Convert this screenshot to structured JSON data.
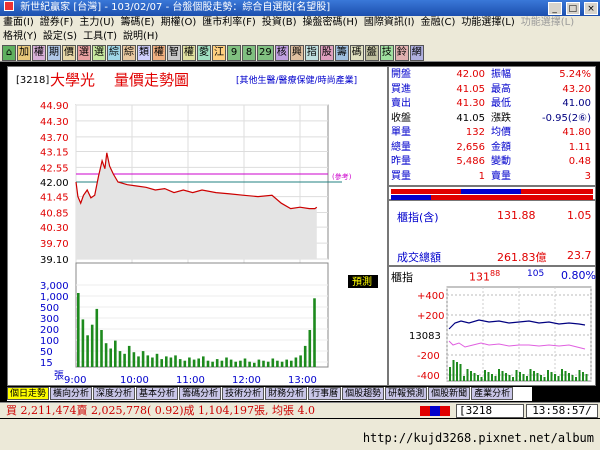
{
  "window": {
    "title": "新世紀贏家 [台灣] - 103/02/07 - 台盤個股走勢：綜合自選股[名望股]",
    "controls": [
      "_",
      "□",
      "×"
    ]
  },
  "menu1": [
    "畫面(I)",
    "證券(F)",
    "主力(U)",
    "籌碼(E)",
    "期權(O)",
    "匯市利率(F)",
    "投資(B)",
    "操盤密碼(H)",
    "國際資訊(I)",
    "金融(C)",
    "功能選擇(L)",
    "功能選擇(L)"
  ],
  "menu2": [
    "格視(Y)",
    "設定(S)",
    "工具(T)",
    "說明(H)"
  ],
  "toolbar": [
    "⌂",
    "加",
    "權",
    "期",
    "價",
    "選",
    "選",
    "綜",
    "綜",
    "類",
    "權",
    "智",
    "權",
    "愛",
    "江",
    "9",
    "8",
    "29",
    "核",
    "興",
    "指",
    "股",
    "籌",
    "碼",
    "盤",
    "技",
    "鈴",
    "網"
  ],
  "stock": {
    "code": "[3218]",
    "name": "大學光",
    "chart_title": "量價走勢圖",
    "sector": "[其他生醫/醫療保健/時尚產業]",
    "ref_label": "(參考)",
    "predict_label": "預測",
    "vol_axis_label": "張"
  },
  "quote": {
    "rows": [
      {
        "l1": "開盤",
        "v1": "42.00",
        "l2": "振幅",
        "v2": "5.24%"
      },
      {
        "l1": "買進",
        "v1": "41.05",
        "l2": "最高",
        "v2": "43.20"
      },
      {
        "l1": "賣出",
        "v1": "41.30",
        "l2": "最低",
        "v2": "41.00"
      },
      {
        "l1": "收盤",
        "v1": "41.05",
        "l2": "漲跌",
        "v2": "-0.95(2⑥)"
      },
      {
        "l1": "單量",
        "v1": "132",
        "l2": "均價",
        "v2": "41.80"
      },
      {
        "l1": "總量",
        "v1": "2,656",
        "l2": "金額",
        "v2": "1.11"
      },
      {
        "l1": "昨量",
        "v1": "5,486",
        "l2": "變動",
        "v2": "0.48"
      },
      {
        "l1": "買量",
        "v1": "1",
        "l2": "賣量",
        "v2": "3"
      }
    ]
  },
  "index_box": {
    "label1": "櫃指(含)",
    "value1": "131.88",
    "change1": "1.05",
    "label2": "成交總額",
    "value2": "261.83億",
    "change2": "23.7"
  },
  "mini": {
    "label": "櫃指",
    "value": "131",
    "value_sup": "88",
    "change": "105",
    "pct": "0.80%",
    "y_labels": [
      "+400",
      "+200",
      "13083",
      "-200",
      "-400"
    ]
  },
  "tabs": [
    "個日走勢",
    "橫向分析",
    "深度分析",
    "基本分析",
    "籌碼分析",
    "技術分析",
    "財務分析",
    "行事曆",
    "個股趨勢",
    "研報預測",
    "個股新聞",
    "產業分析"
  ],
  "status": {
    "summary": "買 2,211,474賣 2,025,778( 0.92)成 1,104,197張, 均張 4.0",
    "code": "[3218",
    "clock": "13:58:57/"
  },
  "url": "http://kujd3268.pixnet.net/album",
  "colors": {
    "up": "#e00000",
    "down": "#0000cc",
    "price_line": "#cc0000",
    "avg_line": "#cc00cc",
    "volume": "#1d8a1d",
    "chart_bg": "#ffffff"
  },
  "chart_data": {
    "type": "line",
    "x_ticks": [
      "9:00",
      "10:00",
      "11:00",
      "12:00",
      "13:00"
    ],
    "price_ticks": [
      "44.90",
      "44.30",
      "43.70",
      "43.15",
      "42.55",
      "42.00",
      "41.45",
      "40.85",
      "40.30",
      "39.70",
      "39.10"
    ],
    "volume_ticks": [
      "3,000",
      "1,000",
      "500",
      "300",
      "200",
      "100",
      "50",
      "15"
    ],
    "price_range": [
      39.1,
      44.9
    ],
    "ref_price": 42.0,
    "avg_price": 42.3,
    "price_series": [
      [
        0,
        42.0
      ],
      [
        2,
        41.45
      ],
      [
        5,
        41.2
      ],
      [
        8,
        41.5
      ],
      [
        12,
        41.7
      ],
      [
        16,
        41.4
      ],
      [
        20,
        41.5
      ],
      [
        24,
        42.2
      ],
      [
        28,
        42.8
      ],
      [
        31,
        42.5
      ],
      [
        33,
        43.1
      ],
      [
        36,
        42.6
      ],
      [
        40,
        42.3
      ],
      [
        45,
        42.0
      ],
      [
        55,
        41.9
      ],
      [
        65,
        41.85
      ],
      [
        75,
        41.8
      ],
      [
        85,
        41.7
      ],
      [
        95,
        41.75
      ],
      [
        105,
        41.6
      ],
      [
        115,
        41.7
      ],
      [
        125,
        41.6
      ],
      [
        135,
        41.7
      ],
      [
        150,
        41.6
      ],
      [
        165,
        41.55
      ],
      [
        180,
        41.5
      ],
      [
        195,
        41.45
      ],
      [
        210,
        41.5
      ],
      [
        220,
        41.2
      ],
      [
        230,
        41.0
      ],
      [
        240,
        41.05
      ],
      [
        250,
        41.0
      ],
      [
        256,
        41.0
      ],
      [
        258,
        41.05
      ]
    ],
    "volume_series": [
      140,
      90,
      60,
      80,
      110,
      70,
      45,
      35,
      50,
      30,
      25,
      40,
      28,
      20,
      30,
      22,
      18,
      25,
      15,
      20,
      18,
      22,
      15,
      12,
      18,
      14,
      16,
      20,
      12,
      10,
      15,
      12,
      18,
      14,
      10,
      12,
      16,
      10,
      8,
      14,
      12,
      10,
      16,
      12,
      10,
      14,
      12,
      18,
      22,
      40,
      70,
      130
    ]
  }
}
